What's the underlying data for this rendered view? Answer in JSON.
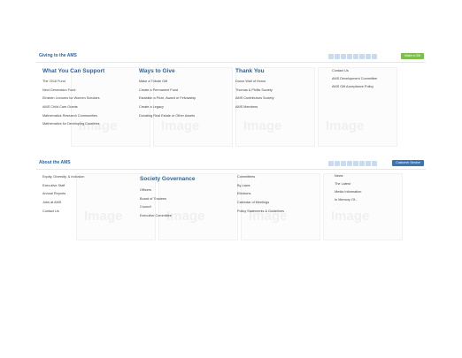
{
  "giving": {
    "title": "Giving to the AMS",
    "button": "Make a Gift",
    "tile_label": "Image",
    "columns": [
      {
        "heading": "What You Can Support",
        "links": [
          "The 2016 Fund",
          "Next Generation Fund",
          "Einstein Lectures for Women Scholars",
          "AMS Child Care Grants",
          "Mathematics Research Communities",
          "Mathematics for Developing Countries"
        ]
      },
      {
        "heading": "Ways to Give",
        "links": [
          "Make a Tribute Gift",
          "Create a Permanent Fund",
          "Establish a Prize, Award or Fellowship",
          "Create a Legacy",
          "Donating Real Estate or Other Assets"
        ]
      },
      {
        "heading": "Thank You",
        "links": [
          "Donor Wall of Honor",
          "Thomas & Phillis Society",
          "AMS Contributors Society",
          "AMS Members"
        ]
      },
      {
        "heading": "Contact Us",
        "links": [
          "AMS Development Committee",
          "AMS Gift Acceptance Policy"
        ]
      }
    ]
  },
  "about": {
    "title": "About the AMS",
    "button": "Customer Service",
    "tile_label": "Image",
    "columns": [
      {
        "heading": "",
        "links": [
          "Equity, Diversity, & Inclusion",
          "Executive Staff",
          "Annual Reports",
          "Jobs at AMS",
          "Contact Us"
        ]
      },
      {
        "heading": "Society Governance",
        "links": [
          "Officers",
          "Board of Trustees",
          "Council",
          "Executive Committee"
        ]
      },
      {
        "heading": "",
        "links": [
          "Committees",
          "By-Laws",
          "Elections",
          "Calendar of Meetings",
          "Policy Statements & Guidelines"
        ]
      },
      {
        "heading": "News",
        "links": [
          "The Latest",
          "Media Information",
          "In Memory Of..."
        ]
      }
    ]
  }
}
